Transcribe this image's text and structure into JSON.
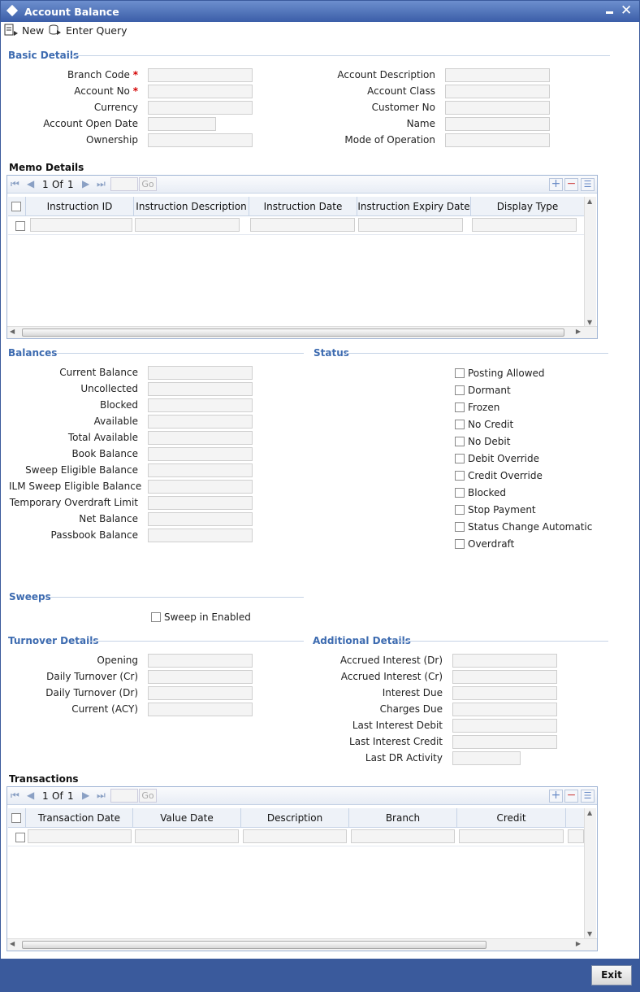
{
  "window": {
    "title": "Account Balance"
  },
  "toolbar": {
    "new_label": "New",
    "enter_query_label": "Enter Query"
  },
  "basic_details": {
    "title": "Basic Details",
    "left": [
      {
        "label": "Branch Code",
        "required": "*",
        "value": ""
      },
      {
        "label": "Account No",
        "required": "*",
        "value": ""
      },
      {
        "label": "Currency",
        "required": "",
        "value": ""
      },
      {
        "label": "Account Open Date",
        "required": "",
        "value": ""
      },
      {
        "label": "Ownership",
        "required": "",
        "value": ""
      }
    ],
    "right": [
      {
        "label": "Account Description",
        "value": ""
      },
      {
        "label": "Account Class",
        "value": ""
      },
      {
        "label": "Customer No",
        "value": ""
      },
      {
        "label": "Name",
        "value": ""
      },
      {
        "label": "Mode of Operation",
        "value": ""
      }
    ]
  },
  "memo_details": {
    "title": "Memo Details",
    "pager": {
      "page": "1",
      "of": "Of",
      "total": "1",
      "go": "Go"
    },
    "columns": [
      "Instruction ID",
      "Instruction Description",
      "Instruction Date",
      "Instruction Expiry Date",
      "Display Type"
    ]
  },
  "balances": {
    "title": "Balances",
    "items": [
      {
        "label": "Current Balance",
        "value": ""
      },
      {
        "label": "Uncollected",
        "value": ""
      },
      {
        "label": "Blocked",
        "value": ""
      },
      {
        "label": "Available",
        "value": ""
      },
      {
        "label": "Total Available",
        "value": ""
      },
      {
        "label": "Book Balance",
        "value": ""
      },
      {
        "label": "Sweep Eligible Balance",
        "value": ""
      },
      {
        "label": "ILM Sweep Eligible Balance",
        "value": ""
      },
      {
        "label": "Temporary Overdraft Limit",
        "value": ""
      },
      {
        "label": "Net Balance",
        "value": ""
      },
      {
        "label": "Passbook Balance",
        "value": ""
      }
    ]
  },
  "status": {
    "title": "Status",
    "items": [
      "Posting Allowed",
      "Dormant",
      "Frozen",
      "No Credit",
      "No Debit",
      "Debit Override",
      "Credit Override",
      "Blocked",
      "Stop Payment",
      "Status Change Automatic",
      "Overdraft"
    ]
  },
  "sweeps": {
    "title": "Sweeps",
    "sweep_in_enabled": "Sweep in Enabled"
  },
  "turnover": {
    "title": "Turnover Details",
    "items": [
      {
        "label": "Opening",
        "value": ""
      },
      {
        "label": "Daily Turnover (Cr)",
        "value": ""
      },
      {
        "label": "Daily Turnover (Dr)",
        "value": ""
      },
      {
        "label": "Current (ACY)",
        "value": ""
      }
    ]
  },
  "additional": {
    "title": "Additional Details",
    "items": [
      {
        "label": "Accrued Interest (Dr)",
        "value": ""
      },
      {
        "label": "Accrued Interest (Cr)",
        "value": ""
      },
      {
        "label": "Interest Due",
        "value": ""
      },
      {
        "label": "Charges Due",
        "value": ""
      },
      {
        "label": "Last Interest Debit",
        "value": ""
      },
      {
        "label": "Last Interest Credit",
        "value": ""
      },
      {
        "label": "Last DR Activity",
        "value": ""
      }
    ]
  },
  "transactions": {
    "title": "Transactions",
    "pager": {
      "page": "1",
      "of": "Of",
      "total": "1",
      "go": "Go"
    },
    "columns": [
      "Transaction Date",
      "Value Date",
      "Description",
      "Branch",
      "Credit"
    ]
  },
  "footer": {
    "exit_label": "Exit"
  },
  "icons": {
    "pager_first": "⏮",
    "pager_prev": "◀",
    "pager_next": "▶",
    "pager_last": "⏭",
    "add": "+",
    "delete": "−",
    "view": "☰"
  }
}
